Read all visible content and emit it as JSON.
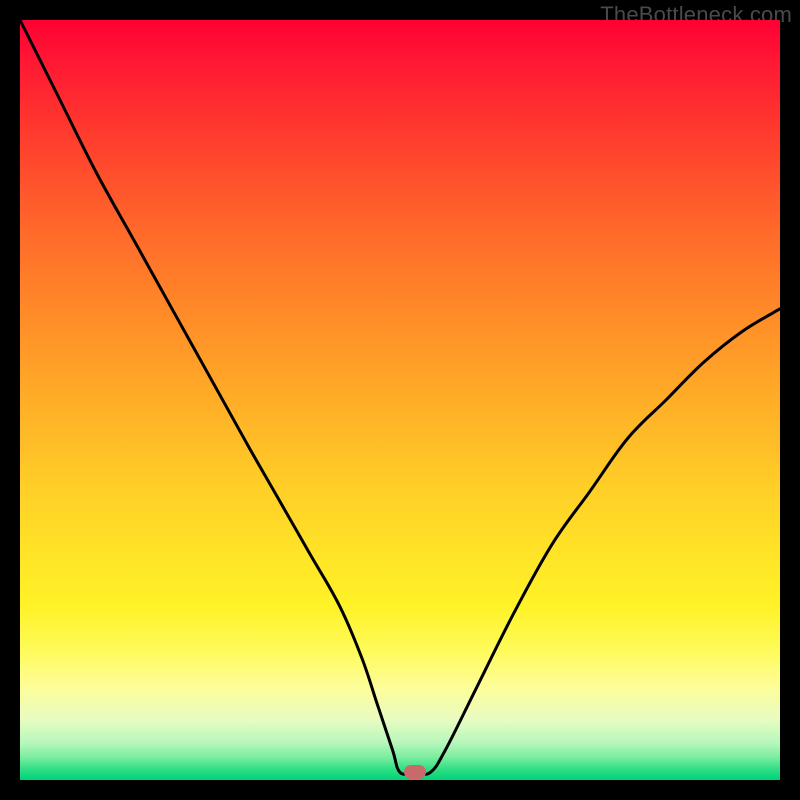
{
  "watermark": "TheBottleneck.com",
  "marker": {
    "x_pct": 52.0,
    "y_pct": 99.0
  },
  "chart_data": {
    "type": "line",
    "title": "",
    "xlabel": "",
    "ylabel": "",
    "xlim": [
      0,
      100
    ],
    "ylim": [
      0,
      100
    ],
    "series": [
      {
        "name": "bottleneck-curve",
        "x": [
          0,
          5,
          10,
          15,
          20,
          25,
          30,
          34,
          38,
          42,
          45,
          47,
          49,
          50,
          52,
          54,
          56,
          60,
          65,
          70,
          75,
          80,
          85,
          90,
          95,
          100
        ],
        "y": [
          100,
          90,
          80,
          71,
          62,
          53,
          44,
          37,
          30,
          23,
          16,
          10,
          4,
          1,
          1,
          1,
          4,
          12,
          22,
          31,
          38,
          45,
          50,
          55,
          59,
          62
        ]
      }
    ],
    "annotations": [
      {
        "label": "optimal-point",
        "x": 52,
        "y": 1
      }
    ]
  }
}
